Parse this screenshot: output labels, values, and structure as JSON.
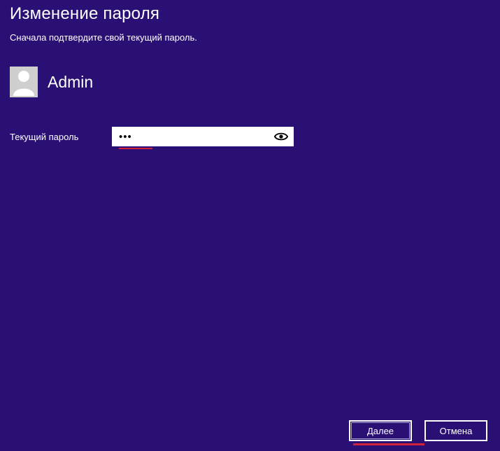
{
  "title": "Изменение пароля",
  "subtitle": "Сначала подтвердите свой текущий пароль.",
  "user": {
    "name": "Admin"
  },
  "field": {
    "label": "Текущий пароль",
    "value": "•••"
  },
  "buttons": {
    "next": "Далее",
    "cancel": "Отмена"
  }
}
